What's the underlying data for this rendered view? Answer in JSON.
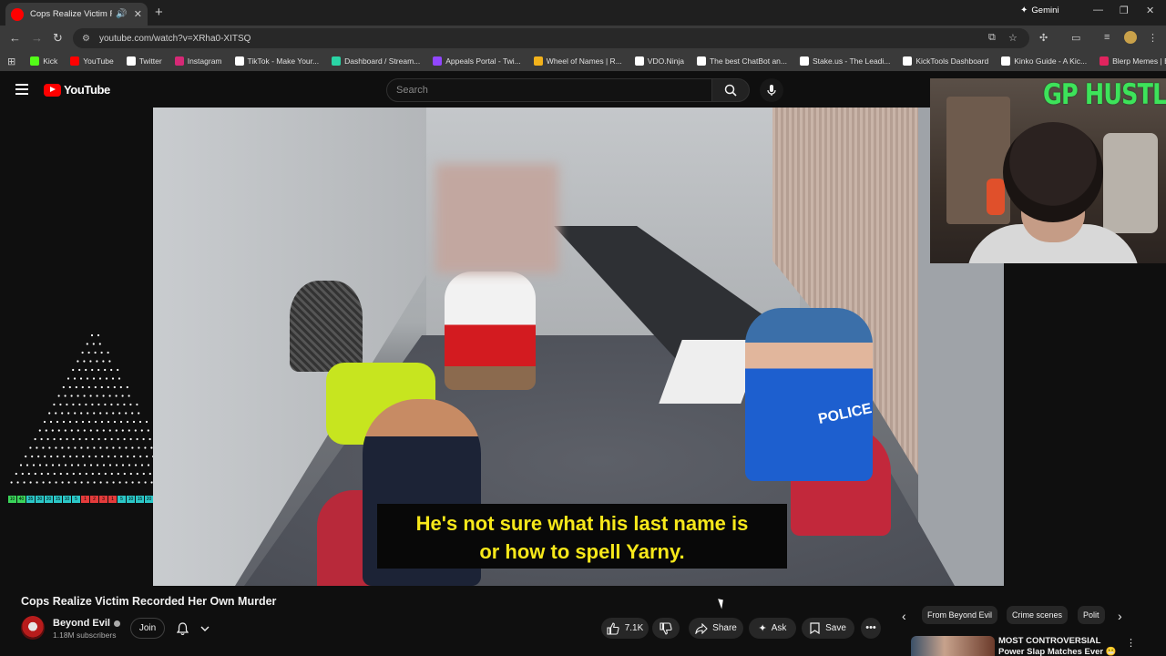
{
  "browser": {
    "tab_title": "Cops Realize Victim Recorde",
    "gemini_label": "Gemini",
    "url": "youtube.com/watch?v=XRha0-XITSQ",
    "bookmarks": [
      {
        "label": "Kick",
        "icon": "kick-icon",
        "color": "#53fc18"
      },
      {
        "label": "YouTube",
        "icon": "youtube-icon",
        "color": "#ff0000"
      },
      {
        "label": "Twitter",
        "icon": "x-icon",
        "color": "#ffffff"
      },
      {
        "label": "Instagram",
        "icon": "instagram-icon",
        "color": "#d62976"
      },
      {
        "label": "TikTok - Make Your...",
        "icon": "tiktok-icon",
        "color": "#ffffff"
      },
      {
        "label": "Dashboard / Stream...",
        "icon": "dashboard-icon",
        "color": "#2ad4a5"
      },
      {
        "label": "Appeals Portal - Twi...",
        "icon": "twitch-icon",
        "color": "#9146ff"
      },
      {
        "label": "Wheel of Names | R...",
        "icon": "wheel-icon",
        "color": "#f2b21b"
      },
      {
        "label": "VDO.Ninja",
        "icon": "vdo-icon",
        "color": "#ffffff"
      },
      {
        "label": "The best ChatBot an...",
        "icon": "chatbot-icon",
        "color": "#ffffff"
      },
      {
        "label": "Stake.us - The Leadi...",
        "icon": "stake-icon",
        "color": "#ffffff"
      },
      {
        "label": "KickTools Dashboard",
        "icon": "kicktools-icon",
        "color": "#ffffff"
      },
      {
        "label": "Kinko Guide - A Kic...",
        "icon": "kinko-icon",
        "color": "#ffffff"
      },
      {
        "label": "Blerp Memes | Best...",
        "icon": "blerp-icon",
        "color": "#e0245e"
      }
    ]
  },
  "youtube": {
    "logo_text": "YouTube",
    "search_placeholder": "Search"
  },
  "video": {
    "subtitle_line1": "He's not sure what his last name is",
    "subtitle_line2": "or how to spell Yarny.",
    "title": "Cops Realize Victim Recorded Her Own Murder",
    "police_text": "POLICE"
  },
  "webcam": {
    "brand_text": "GP HUSTLA"
  },
  "meter": {
    "values": [
      "10",
      "40",
      "35",
      "30",
      "20",
      "15",
      "10",
      "5",
      "1",
      "2",
      "3",
      "1",
      "5",
      "10",
      "15",
      "20",
      "25",
      "30",
      "100"
    ],
    "colors": [
      "#3ad45a",
      "#3ad45a",
      "#2bc7c7",
      "#2bc7c7",
      "#2bc7c7",
      "#2bc7c7",
      "#2bc7c7",
      "#2bc7c7",
      "#e43b3b",
      "#e43b3b",
      "#e43b3b",
      "#e43b3b",
      "#2bc7c7",
      "#2bc7c7",
      "#2bc7c7",
      "#2bc7c7",
      "#2bc7c7",
      "#2bc7c7",
      "#3ad45a"
    ]
  },
  "channel": {
    "name": "Beyond Evil",
    "subscribers": "1.18M subscribers",
    "join_label": "Join"
  },
  "actions": {
    "likes": "7.1K",
    "share_label": "Share",
    "ask_label": "Ask",
    "save_label": "Save"
  },
  "chips": [
    "From Beyond Evil",
    "Crime scenes",
    "Polit"
  ],
  "recommended": {
    "title": "MOST CONTROVERSIAL Power Slap Matches Ever 😬😬"
  }
}
